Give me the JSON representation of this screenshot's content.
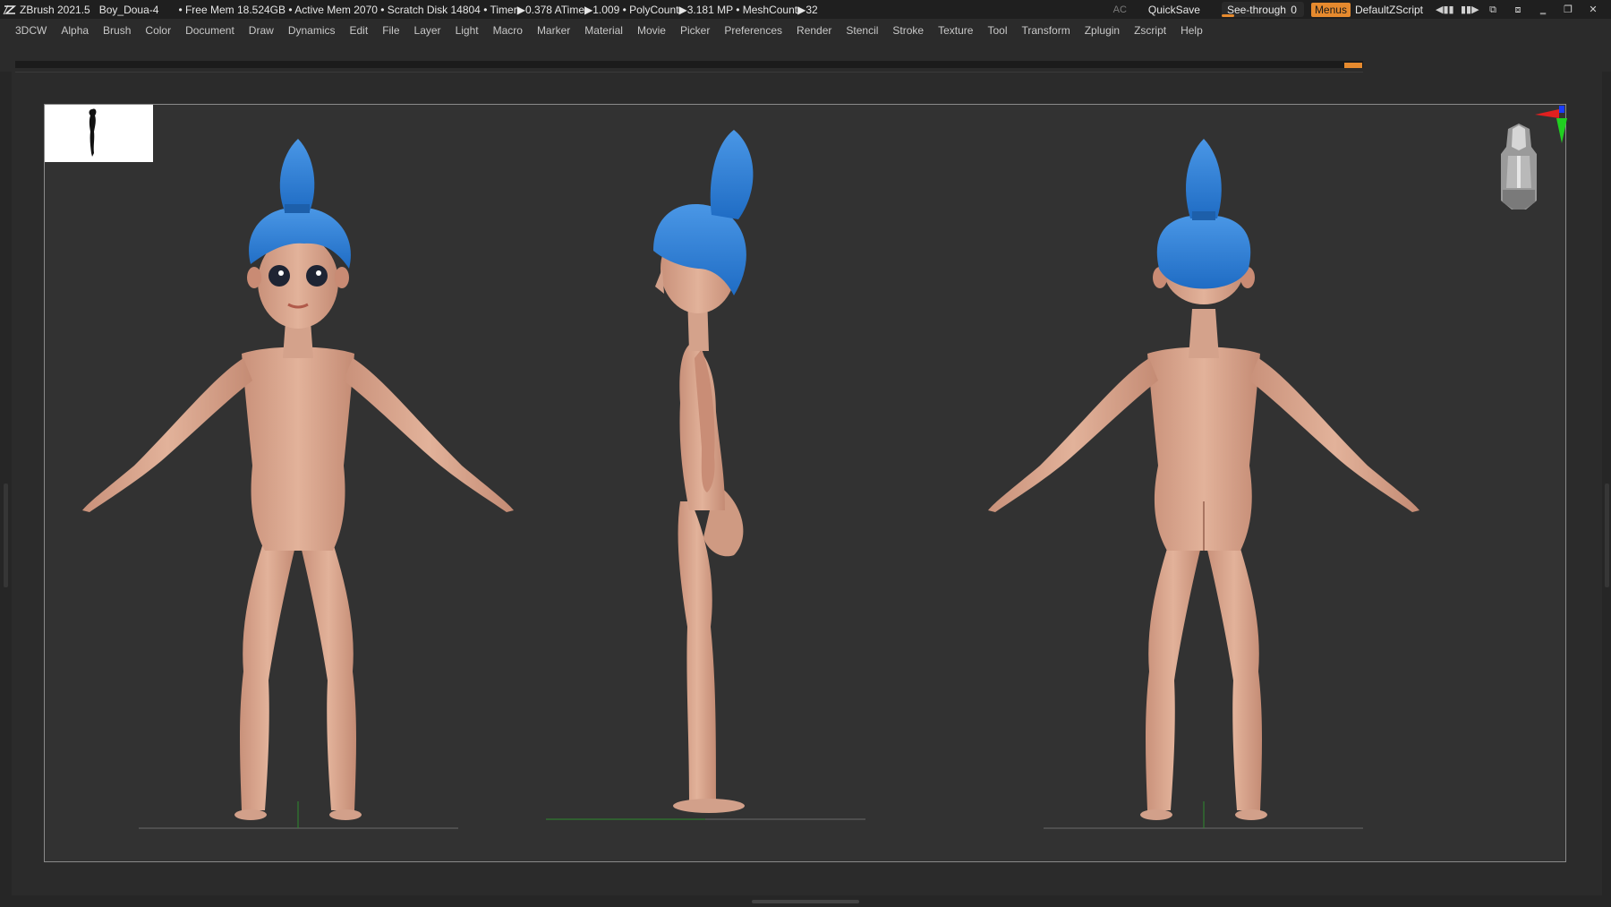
{
  "app": {
    "name": "ZBrush 2021.5",
    "document": "Boy_Doua-4",
    "stats": "• Free Mem 18.524GB • Active Mem 2070 • Scratch Disk 14804 •  Timer▶0.378 ATime▶1.009 • PolyCount▶3.181 MP  • MeshCount▶32"
  },
  "titlebar_right": {
    "ac_label": "AC",
    "quicksave_label": "QuickSave",
    "seethrough_label": "See-through",
    "seethrough_value": "0",
    "seethrough_level": 0,
    "menus_label": "Menus",
    "zscript_label": "DefaultZScript"
  },
  "menu": [
    "3DCW",
    "Alpha",
    "Brush",
    "Color",
    "Document",
    "Draw",
    "Dynamics",
    "Edit",
    "File",
    "Layer",
    "Light",
    "Macro",
    "Marker",
    "Material",
    "Movie",
    "Picker",
    "Preferences",
    "Render",
    "Stencil",
    "Stroke",
    "Texture",
    "Tool",
    "Transform",
    "Zplugin",
    "Zscript",
    "Help"
  ],
  "colors": {
    "accent": "#e68a2e",
    "skin": "#d9a48a",
    "hair": "#2f7fd6",
    "background": "#2b2b2b",
    "document": "#323232"
  },
  "viewport": {
    "views": [
      "front",
      "side",
      "back"
    ],
    "gizmo_axes": [
      "x-red",
      "y-green",
      "z-blue"
    ]
  }
}
